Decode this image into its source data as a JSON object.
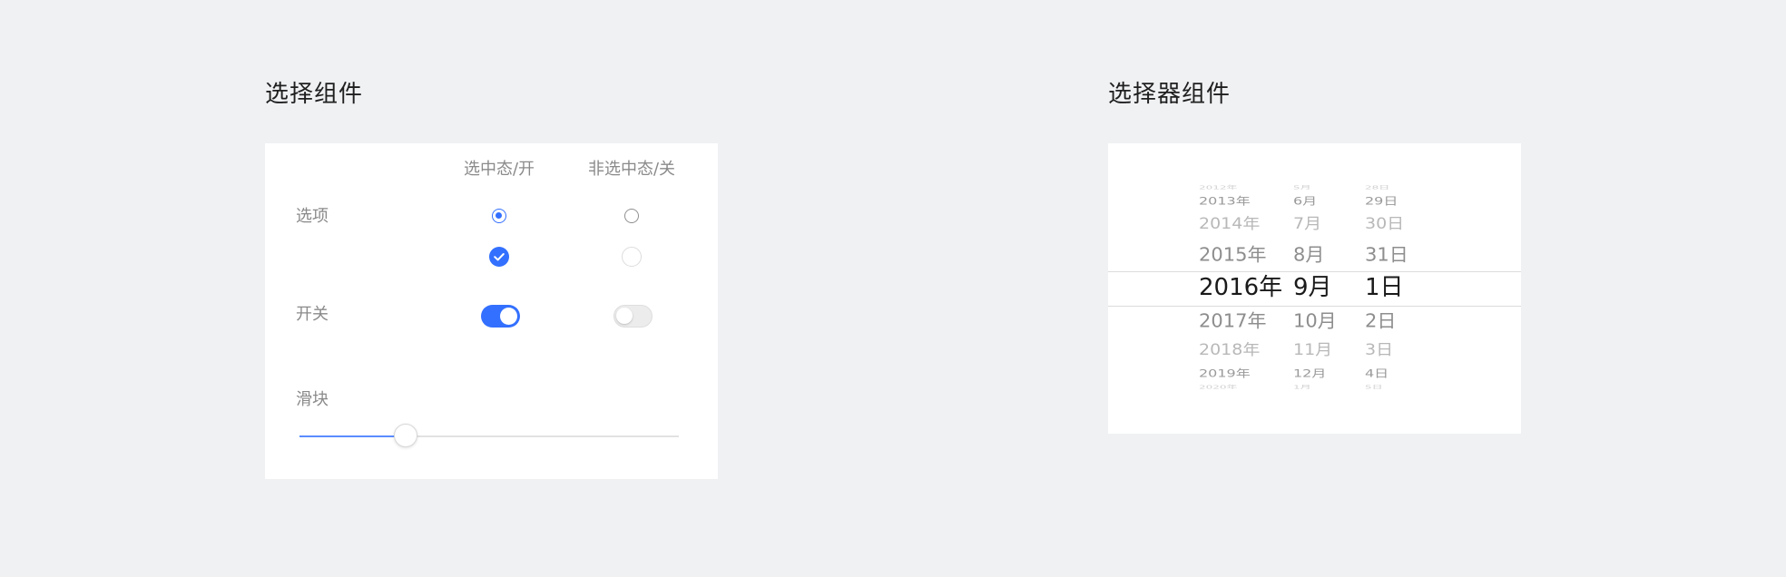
{
  "selection_section": {
    "title": "选择组件",
    "headers": {
      "on": "选中态/开",
      "off": "非选中态/关"
    },
    "rows": {
      "option": "选项",
      "switch": "开关",
      "slider": "滑块"
    },
    "slider_value": 0.28,
    "accent_color": "#3370ff"
  },
  "picker_section": {
    "title": "选择器组件",
    "years": [
      "2012年",
      "2013年",
      "2014年",
      "2015年",
      "2016年",
      "2017年",
      "2018年",
      "2019年",
      "2020年"
    ],
    "months": [
      "5月",
      "6月",
      "7月",
      "8月",
      "9月",
      "10月",
      "11月",
      "12月",
      "1月"
    ],
    "days": [
      "28日",
      "29日",
      "30日",
      "31日",
      "1日",
      "2日",
      "3日",
      "4日",
      "5日"
    ],
    "selected_index": 4
  }
}
